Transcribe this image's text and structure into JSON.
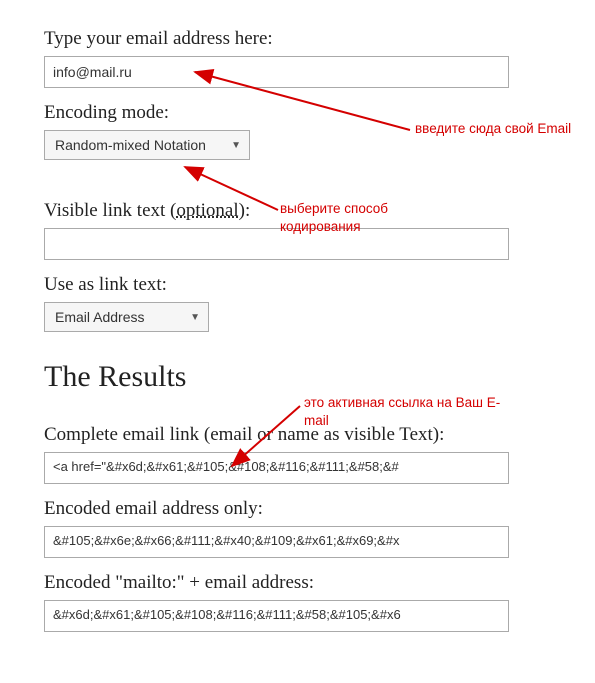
{
  "email_label": "Type your email address here:",
  "email_value": "info@mail.ru",
  "encoding_label": "Encoding mode:",
  "encoding_selected": "Random-mixed Notation",
  "visible_label_pre": "Visible link text (",
  "visible_label_opt": "optional",
  "visible_label_post": "):",
  "visible_value": "",
  "useas_label": "Use as link text:",
  "useas_selected": "Email Address",
  "results_heading": "The Results",
  "out1_label": "Complete email link (email or name as visible Text):",
  "out1_value": "<a href=\"&#x6d;&#x61;&#105;&#108;&#116;&#111;&#58;&#",
  "out2_label": "Encoded email address only:",
  "out2_value": "&#105;&#x6e;&#x66;&#111;&#x40;&#109;&#x61;&#x69;&#x",
  "out3_label": "Encoded \"mailto:\" + email address:",
  "out3_value": "&#x6d;&#x61;&#105;&#108;&#116;&#111;&#58;&#105;&#x6",
  "ann_email": "введите сюда свой Email",
  "ann_encoding": "выберите способ кодирования",
  "ann_result": "это активная ссылка на Ваш E-mail"
}
